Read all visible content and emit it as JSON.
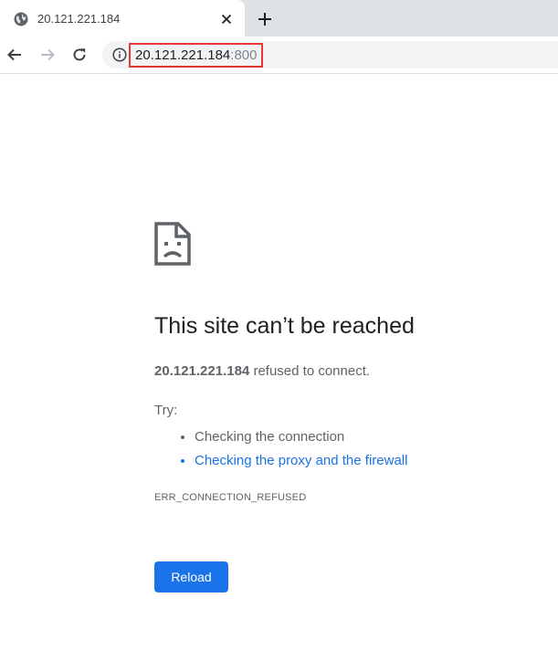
{
  "tab": {
    "title": "20.121.221.184",
    "favicon": "globe-icon"
  },
  "toolbar": {
    "url_host": "20.121.221.184",
    "url_port": ":800",
    "icons": [
      "back-arrow-icon",
      "forward-arrow-icon",
      "reload-icon",
      "info-icon"
    ]
  },
  "error": {
    "headline": "This site can’t be reached",
    "host": "20.121.221.184",
    "summary_rest": " refused to connect.",
    "try_label": "Try:",
    "suggestions": [
      "Checking the connection",
      "Checking the proxy and the firewall"
    ],
    "code": "ERR_CONNECTION_REFUSED",
    "reload_label": "Reload"
  },
  "colors": {
    "accent": "#1a73e8",
    "highlight_box": "#e53935"
  }
}
